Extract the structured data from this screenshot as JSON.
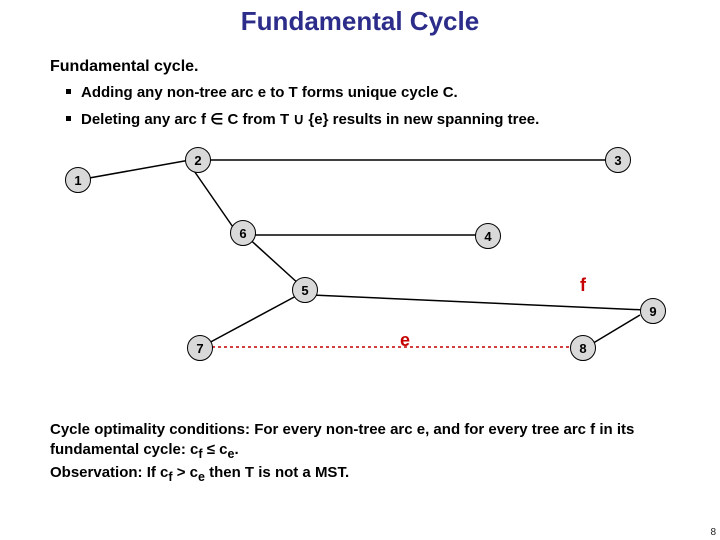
{
  "title": "Fundamental Cycle",
  "subtitle": "Fundamental cycle.",
  "bullets": [
    "Adding any non-tree arc e to T forms unique cycle C.",
    "Deleting any arc f ∈ C from T ∪ {e} results in new spanning tree."
  ],
  "nodes": {
    "n1": "1",
    "n2": "2",
    "n3": "3",
    "n4": "4",
    "n5": "5",
    "n6": "6",
    "n7": "7",
    "n8": "8",
    "n9": "9"
  },
  "edge_labels": {
    "e": "e",
    "f": "f"
  },
  "bottom": {
    "line1_label": "Cycle optimality conditions:",
    "line1_rest": "  For every non-tree arc e, and for every tree arc f in its fundamental cycle:  c",
    "line1_sub1": "f",
    "line1_mid": " ≤ c",
    "line1_sub2": "e",
    "line1_end": ".",
    "line2_label": "Observation:",
    "line2_rest": "  If c",
    "line2_sub1": "f",
    "line2_mid": " > c",
    "line2_sub2": "e",
    "line2_end": " then T is not a MST."
  },
  "page": "8"
}
